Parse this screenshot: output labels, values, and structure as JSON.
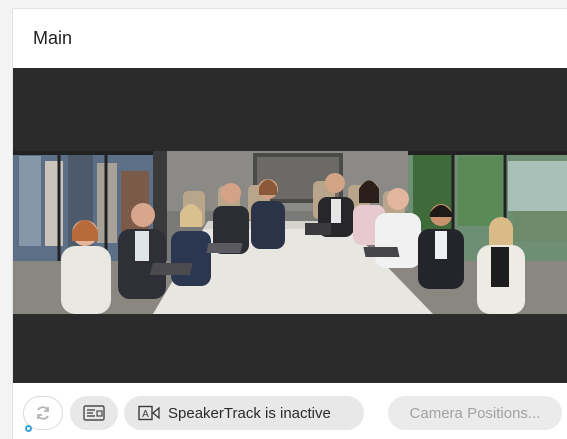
{
  "panel": {
    "title": "Main"
  },
  "controls": {
    "refresh_icon": "refresh-icon",
    "layout_icon": "layout-icon",
    "speakertrack_icon": "speakertrack-icon",
    "speakertrack_label": "SpeakerTrack is inactive",
    "camera_positions_label": "Camera Positions..."
  },
  "colors": {
    "video_background": "#2b2b2b",
    "button_background": "#e8e8e8",
    "disabled_text": "#a2a2a2",
    "focus_ring": "#3aa3d6"
  }
}
